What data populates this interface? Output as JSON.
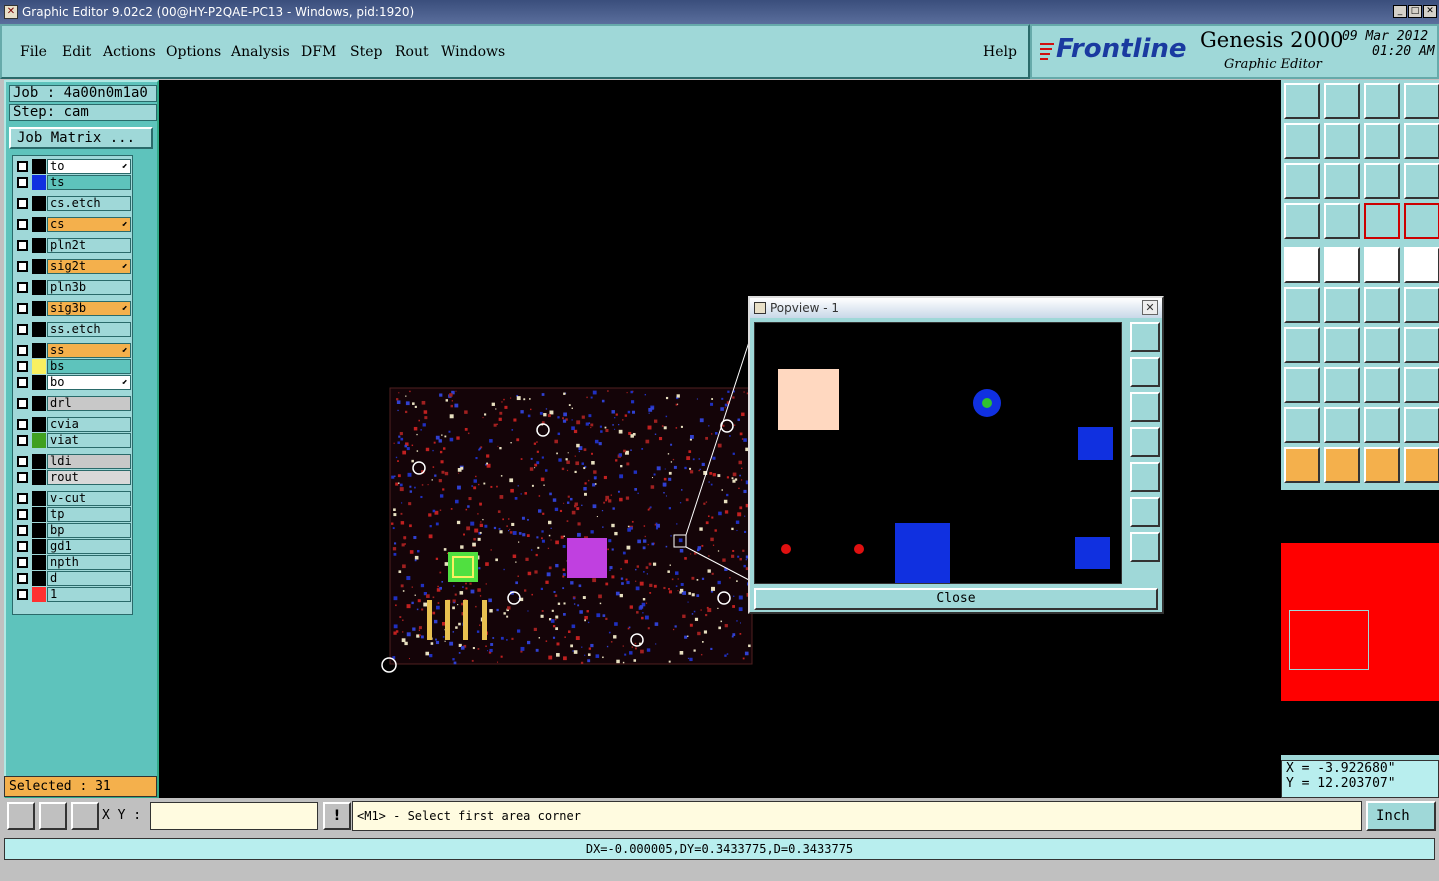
{
  "window": {
    "title": "Graphic Editor 9.02c2 (00@HY-P2QAE-PC13 - Windows, pid:1920)"
  },
  "menu": {
    "items": [
      "File",
      "Edit",
      "Actions",
      "Options",
      "Analysis",
      "DFM",
      "Step",
      "Rout",
      "Windows"
    ],
    "help": "Help"
  },
  "brand": {
    "logo": "Frontline",
    "product": "Genesis 2000",
    "subtitle": "Graphic Editor",
    "date": "09 Mar 2012",
    "time": "01:20 AM"
  },
  "job": {
    "job_label": "Job : 4a00n0m1a0",
    "step_label": "Step: cam",
    "matrix_button": "Job Matrix ..."
  },
  "layers": [
    {
      "name": "to",
      "style": "white",
      "color": "#000000",
      "arrow": true
    },
    {
      "name": "ts",
      "style": "teal",
      "color": "#1030e0",
      "arrow": false
    },
    {
      "name": "cs.etch",
      "style": "plain",
      "color": "#000000",
      "arrow": false
    },
    {
      "name": "cs",
      "style": "orange",
      "color": "#000000",
      "arrow": true
    },
    {
      "name": "pln2t",
      "style": "plain",
      "color": "#000000",
      "arrow": false
    },
    {
      "name": "sig2t",
      "style": "orange",
      "color": "#000000",
      "arrow": true
    },
    {
      "name": "pln3b",
      "style": "plain",
      "color": "#000000",
      "arrow": false
    },
    {
      "name": "sig3b",
      "style": "orange",
      "color": "#000000",
      "arrow": true
    },
    {
      "name": "ss.etch",
      "style": "plain",
      "color": "#000000",
      "arrow": false
    },
    {
      "name": "ss",
      "style": "orange",
      "color": "#000000",
      "arrow": true
    },
    {
      "name": "bs",
      "style": "teal",
      "color": "#f8f060",
      "arrow": false
    },
    {
      "name": "bo",
      "style": "white",
      "color": "#000000",
      "arrow": true
    },
    {
      "name": "drl",
      "style": "grey",
      "color": "#000000",
      "arrow": false
    },
    {
      "name": "cvia",
      "style": "plain",
      "color": "#000000",
      "arrow": false
    },
    {
      "name": "viat",
      "style": "plain",
      "color": "#40a020",
      "arrow": false
    },
    {
      "name": "ldi",
      "style": "grey",
      "color": "#000000",
      "arrow": false
    },
    {
      "name": "rout",
      "style": "lgrey",
      "color": "#000000",
      "arrow": false
    },
    {
      "name": "v-cut",
      "style": "plain",
      "color": "#000000",
      "arrow": false
    },
    {
      "name": "tp",
      "style": "plain",
      "color": "#000000",
      "arrow": false
    },
    {
      "name": "bp",
      "style": "plain",
      "color": "#000000",
      "arrow": false
    },
    {
      "name": "gd1",
      "style": "plain",
      "color": "#000000",
      "arrow": false
    },
    {
      "name": "npth",
      "style": "plain",
      "color": "#000000",
      "arrow": false
    },
    {
      "name": "d",
      "style": "plain",
      "color": "#000000",
      "arrow": false
    },
    {
      "name": "1",
      "style": "plain",
      "color": "#ff3030",
      "arrow": false
    }
  ],
  "selected": "Selected : 31",
  "popview": {
    "title": "Popview - 1",
    "close": "Close"
  },
  "coords": {
    "x": "X = -3.922680\"",
    "y": "Y = 12.203707\""
  },
  "bottom": {
    "xy_label": "X Y :",
    "xy_value": "",
    "prompt": "<M1> - Select first area corner",
    "units": "Inch"
  },
  "status": "DX=-0.000005,DY=0.3433775,D=0.3433775",
  "colors": {
    "panel": "#9fd8d8",
    "accent_orange": "#f4b04c",
    "board_red": "#ff0000"
  }
}
